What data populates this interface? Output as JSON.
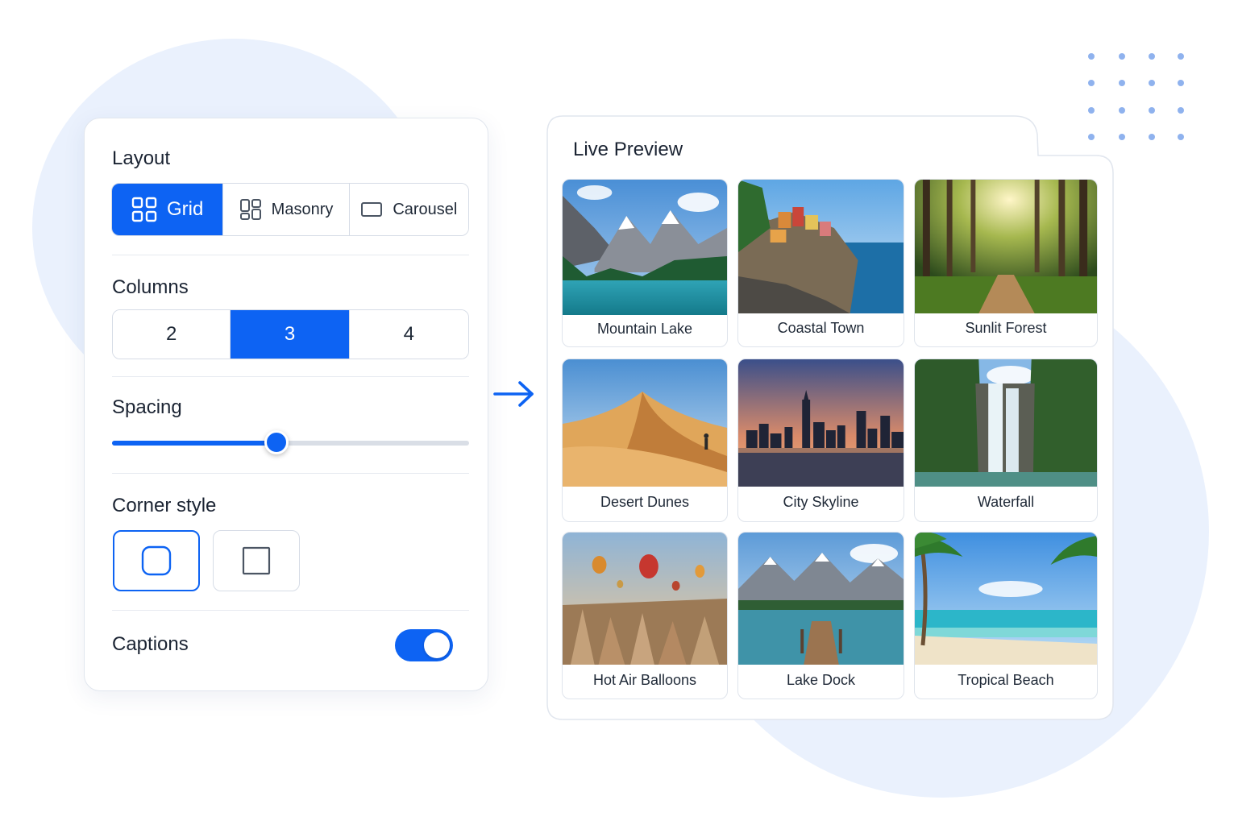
{
  "settings": {
    "layout": {
      "title": "Layout",
      "options": [
        {
          "label": "Grid",
          "icon": "grid-icon",
          "selected": true
        },
        {
          "label": "Masonry",
          "icon": "masonry-icon",
          "selected": false
        },
        {
          "label": "Carousel",
          "icon": "carousel-icon",
          "selected": false
        }
      ]
    },
    "columns": {
      "title": "Columns",
      "options": [
        "2",
        "3",
        "4"
      ],
      "selected": "3"
    },
    "spacing": {
      "title": "Spacing",
      "value": 0.46
    },
    "corner_style": {
      "title": "Corner style",
      "options": [
        {
          "icon": "rounded-corner-icon",
          "selected": true
        },
        {
          "icon": "square-corner-icon",
          "selected": false
        }
      ]
    },
    "captions": {
      "title": "Captions",
      "enabled": true
    }
  },
  "preview": {
    "title": "Live Preview",
    "items": [
      {
        "caption": "Mountain Lake",
        "icon": "mountain-lake-photo"
      },
      {
        "caption": "Coastal Town",
        "icon": "coastal-town-photo"
      },
      {
        "caption": "Sunlit Forest",
        "icon": "sunlit-forest-photo"
      },
      {
        "caption": "Desert Dunes",
        "icon": "desert-dunes-photo"
      },
      {
        "caption": "City Skyline",
        "icon": "city-skyline-photo"
      },
      {
        "caption": "Waterfall",
        "icon": "waterfall-photo"
      },
      {
        "caption": "Hot Air Balloons",
        "icon": "hot-air-balloons-photo"
      },
      {
        "caption": "Lake Dock",
        "icon": "lake-dock-photo"
      },
      {
        "caption": "Tropical Beach",
        "icon": "tropical-beach-photo"
      }
    ]
  },
  "colors": {
    "accent": "#0d63f3",
    "background_blob": "#eaf1fd",
    "border": "#d6dce6"
  }
}
